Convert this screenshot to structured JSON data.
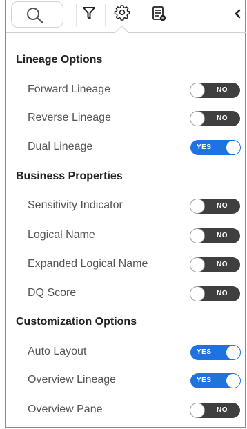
{
  "toolbar": {
    "icons": [
      "search-icon",
      "filter-icon",
      "gear-icon",
      "document-icon",
      "chevron-left-icon"
    ],
    "active": "gear-icon"
  },
  "sections": [
    {
      "title": "Lineage Options",
      "items": [
        {
          "label": "Forward Lineage",
          "state": "NO"
        },
        {
          "label": "Reverse Lineage",
          "state": "NO"
        },
        {
          "label": "Dual Lineage",
          "state": "YES"
        }
      ]
    },
    {
      "title": "Business Properties",
      "items": [
        {
          "label": "Sensitivity Indicator",
          "state": "NO"
        },
        {
          "label": "Logical Name",
          "state": "NO"
        },
        {
          "label": "Expanded Logical Name",
          "state": "NO"
        },
        {
          "label": "DQ Score",
          "state": "NO"
        }
      ]
    },
    {
      "title": "Customization Options",
      "items": [
        {
          "label": "Auto Layout",
          "state": "YES"
        },
        {
          "label": "Overview Lineage",
          "state": "YES"
        },
        {
          "label": "Overview Pane",
          "state": "NO"
        }
      ]
    }
  ],
  "colors": {
    "toggle_on": "#1e73e0",
    "toggle_off": "#3f3f3f"
  }
}
